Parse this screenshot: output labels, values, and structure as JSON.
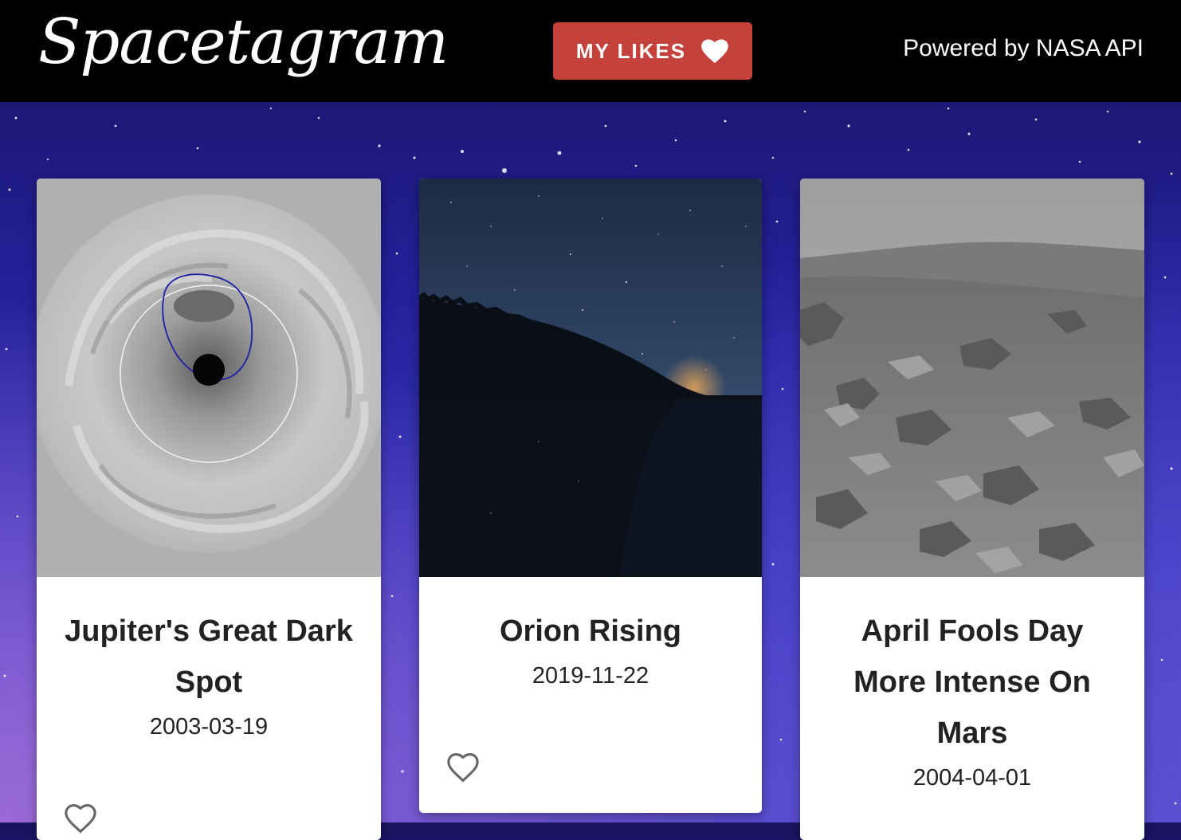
{
  "header": {
    "logo": "Spacetagram",
    "likes_button": "MY LIKES",
    "powered_by": "Powered by NASA API"
  },
  "colors": {
    "header_bg": "#000000",
    "likes_button_bg": "#c5413b",
    "card_bg": "#ffffff"
  },
  "cards": [
    {
      "title": "Jupiter's Great Dark Spot",
      "date": "2003-03-19",
      "liked": false
    },
    {
      "title": "Orion Rising",
      "date": "2019-11-22",
      "liked": false
    },
    {
      "title": "April Fools Day More Intense On Mars",
      "date": "2004-04-01",
      "liked": false
    }
  ]
}
